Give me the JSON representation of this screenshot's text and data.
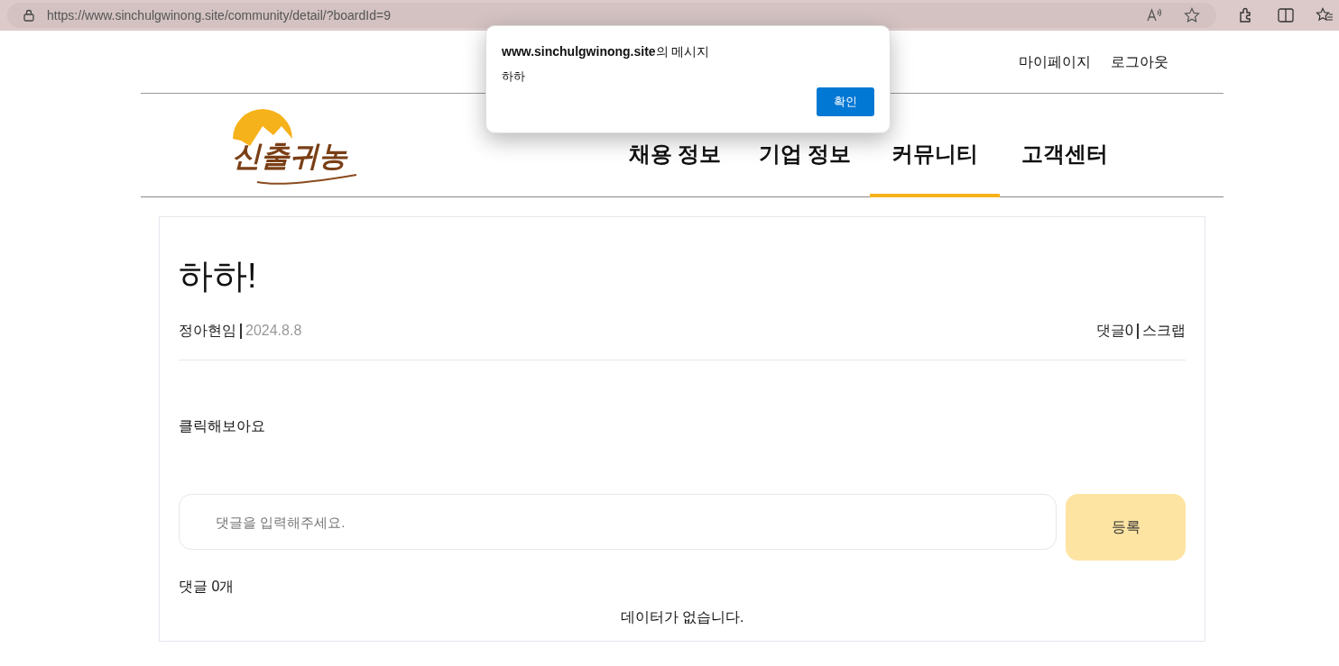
{
  "browser": {
    "url": "https://www.sinchulgwinong.site/community/detail/?boardId=9"
  },
  "top_links": [
    "마이페이지",
    "로그아웃"
  ],
  "logo": {
    "text": "신출귀농"
  },
  "nav": [
    {
      "label": "채용 정보",
      "selected": false
    },
    {
      "label": "기업 정보",
      "selected": false
    },
    {
      "label": "커뮤니티",
      "selected": true
    },
    {
      "label": "고객센터",
      "selected": false
    }
  ],
  "post": {
    "title": "하하!",
    "author": "정아현임",
    "date": "2024.8.8",
    "comments_link": "댓글0",
    "scrap_link": "스크랩",
    "body": "클릭해보아요"
  },
  "comment_form": {
    "placeholder": "댓글을 입력해주세요.",
    "submit": "등록"
  },
  "comments": {
    "count_label": "댓글 0개",
    "empty_message": "데이터가 없습니다."
  },
  "dialog": {
    "title": "**www.sinchulgwinong.site**의 메시지",
    "message": "하하",
    "ok": "확인"
  }
}
